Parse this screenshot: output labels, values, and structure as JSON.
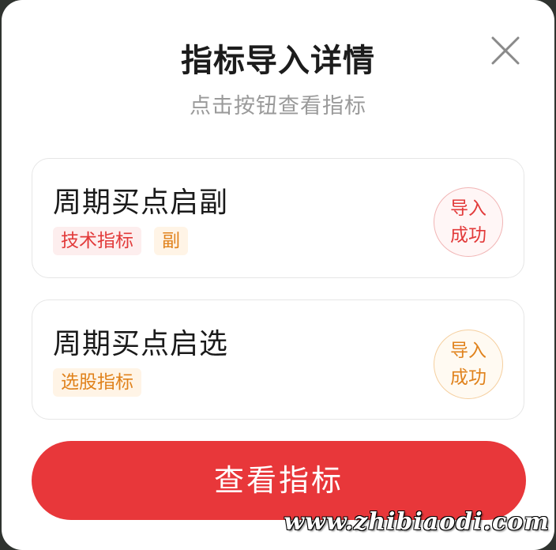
{
  "dialog": {
    "title": "指标导入详情",
    "subtitle": "点击按钮查看指标",
    "close_icon": "close-icon"
  },
  "indicators": [
    {
      "name": "周期买点启副",
      "tags": [
        "技术指标",
        "副"
      ],
      "status_line1": "导入",
      "status_line2": "成功"
    },
    {
      "name": "周期买点启选",
      "tags": [
        "选股指标"
      ],
      "status_line1": "导入",
      "status_line2": "成功"
    }
  ],
  "primary_button": {
    "label": "查看指标"
  },
  "watermark": "www.zhibiaodi.com",
  "colors": {
    "accent_red": "#e8373a",
    "tag_red": "#e23a3a",
    "tag_orange": "#e0821c"
  }
}
